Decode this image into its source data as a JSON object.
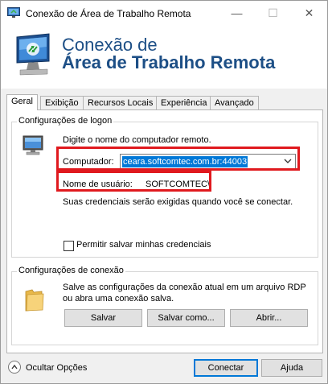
{
  "window": {
    "title": "Conexão de Área de Trabalho Remota",
    "minimize_glyph": "—",
    "maximize_glyph": "☐",
    "close_glyph": "✕"
  },
  "banner": {
    "line1": "Conexão de",
    "line2": "Área de Trabalho Remota",
    "icon": "remote-desktop-icon"
  },
  "tabs": [
    {
      "label": "Geral",
      "active": true
    },
    {
      "label": "Exibição",
      "active": false
    },
    {
      "label": "Recursos Locais",
      "active": false
    },
    {
      "label": "Experiência",
      "active": false
    },
    {
      "label": "Avançado",
      "active": false
    }
  ],
  "logon": {
    "group_title": "Configurações de logon",
    "instruction": "Digite o nome do computador remoto.",
    "computer_label": "Computador:",
    "computer_value": "ceara.softcomtec.com.br:44003",
    "username_label": "Nome de usuário:",
    "username_value": "SOFTCOMTEC\\",
    "credentials_note": "Suas credenciais serão exigidas quando você se conectar.",
    "save_credentials_label": "Permitir salvar minhas credenciais",
    "save_credentials_checked": false
  },
  "connection": {
    "group_title": "Configurações de conexão",
    "description_line1": "Salve as configurações da conexão atual em um arquivo RDP",
    "description_line2": "ou abra uma conexão salva.",
    "save_label": "Salvar",
    "save_as_label": "Salvar como...",
    "open_label": "Abrir..."
  },
  "footer": {
    "hide_options_label": "Ocultar Opções",
    "connect_label": "Conectar",
    "help_label": "Ajuda"
  },
  "colors": {
    "accent": "#0078d7",
    "highlight_box": "#e0191e",
    "banner_text": "#1d4f86"
  }
}
